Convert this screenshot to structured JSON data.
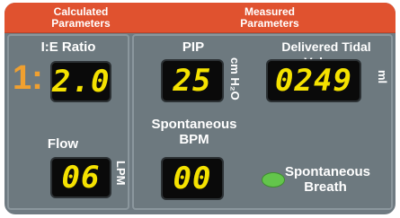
{
  "header": {
    "left_title": "Calculated Parameters",
    "right_title": "Measured Parameters",
    "color": "#e0522f"
  },
  "calculated": {
    "ie_ratio": {
      "label": "I:E Ratio",
      "prefix": "1:",
      "value": "2.0"
    },
    "flow": {
      "label": "Flow",
      "value": "06",
      "unit": "LPM"
    }
  },
  "measured": {
    "pip": {
      "label": "PIP",
      "value": "25",
      "unit": "cm H₂O"
    },
    "delivered_tidal_volume": {
      "label": "Delivered Tidal Volume",
      "value": "0249",
      "unit": "ml"
    },
    "spontaneous_bpm": {
      "label": "Spontaneous BPM",
      "value": "00"
    },
    "spontaneous_breath": {
      "label": "Spontaneous Breath",
      "indicator_color": "#63c54b"
    }
  },
  "colors": {
    "panel": "#6d797f",
    "display_bg": "#0a0a0a",
    "digits": "#f5e200",
    "ratio_prefix": "#f0a030"
  }
}
